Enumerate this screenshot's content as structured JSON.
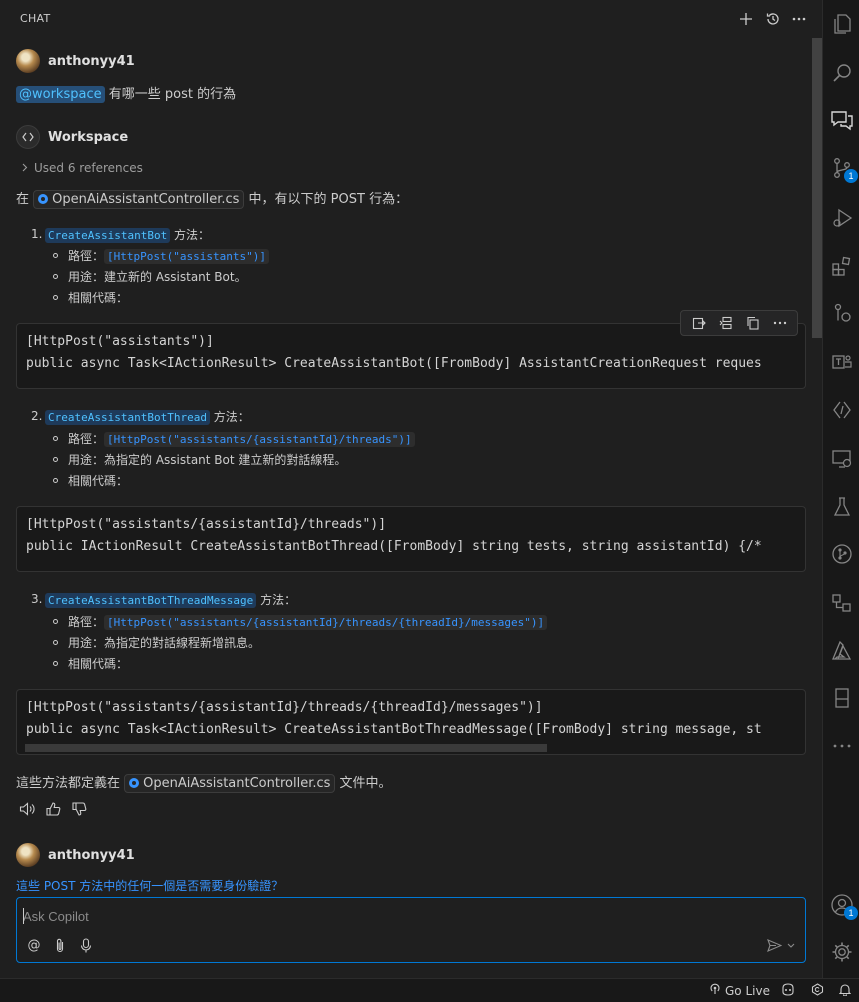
{
  "panel": {
    "title": "CHAT"
  },
  "messages": {
    "user1": {
      "name": "anthonyy41",
      "agent": "@workspace",
      "text": " 有哪一些 post 的行為"
    },
    "assistant": {
      "name": "Workspace",
      "references": "Used 6 references",
      "intro_prefix": "在 ",
      "intro_file": "OpenAiAssistantController.cs",
      "intro_suffix": " 中，有以下的 POST 行為：",
      "items": [
        {
          "number": "1.",
          "method": "CreateAssistantBot",
          "method_suffix": " 方法：",
          "path_label": "路徑：",
          "path": "[HttpPost(\"assistants\")]",
          "usage": "用途：建立新的 Assistant Bot。",
          "code_label": "相關代碼：",
          "code": [
            "[HttpPost(\"assistants\")]",
            "public async Task<IActionResult> CreateAssistantBot([FromBody] AssistantCreationRequest reques"
          ]
        },
        {
          "number": "2.",
          "method": "CreateAssistantBotThread",
          "method_suffix": " 方法：",
          "path_label": "路徑：",
          "path": "[HttpPost(\"assistants/{assistantId}/threads\")]",
          "usage": "用途：為指定的 Assistant Bot 建立新的對話線程。",
          "code_label": "相關代碼：",
          "code": [
            "[HttpPost(\"assistants/{assistantId}/threads\")]",
            "public IActionResult CreateAssistantBotThread([FromBody] string tests, string assistantId) {/*"
          ]
        },
        {
          "number": "3.",
          "method": "CreateAssistantBotThreadMessage",
          "method_suffix": " 方法：",
          "path_label": "路徑：",
          "path": "[HttpPost(\"assistants/{assistantId}/threads/{threadId}/messages\")]",
          "usage": "用途：為指定的對話線程新增訊息。",
          "code_label": "相關代碼：",
          "code": [
            "[HttpPost(\"assistants/{assistantId}/threads/{threadId}/messages\")]",
            "public async Task<IActionResult> CreateAssistantBotThreadMessage([FromBody] string message, st"
          ]
        }
      ],
      "outro_prefix": "這些方法都定義在 ",
      "outro_file": "OpenAiAssistantController.cs",
      "outro_suffix": " 文件中。"
    },
    "user2": {
      "name": "anthonyy41",
      "text": "這些 POST 方法中的任何一個是否需要身份驗證？"
    }
  },
  "input": {
    "placeholder": "Ask Copilot",
    "value": ""
  },
  "activity_badges": {
    "source_control": "1",
    "accounts": "1"
  },
  "status": {
    "go_live": "Go Live"
  },
  "colors": {
    "accent": "#0078d4",
    "link": "#3794ff",
    "background": "#1f1f1f"
  }
}
